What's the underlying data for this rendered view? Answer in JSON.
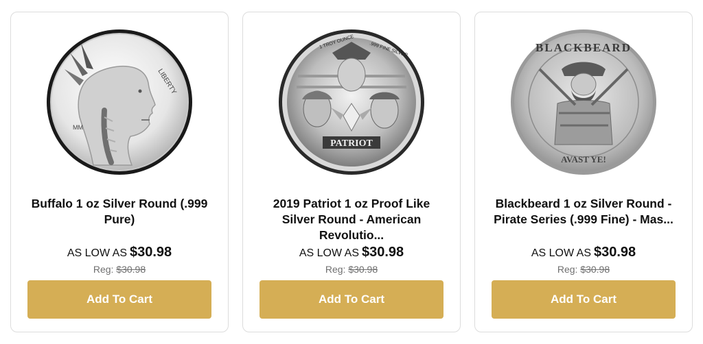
{
  "products": [
    {
      "title": "Buffalo 1 oz Silver Round (.999 Pure)",
      "price_prefix": "AS LOW AS",
      "price": "$30.98",
      "reg_label": "Reg:",
      "reg_price": "$30.98",
      "button_label": "Add To Cart",
      "image_icon": "buffalo-silver-round-coin",
      "coin_text": [
        "LIBERTY",
        "MM"
      ]
    },
    {
      "title": "2019 Patriot 1 oz Proof Like Silver Round - American Revolutio...",
      "price_prefix": "AS LOW AS",
      "price": "$30.98",
      "reg_label": "Reg:",
      "reg_price": "$30.98",
      "button_label": "Add To Cart",
      "image_icon": "patriot-silver-round-coin",
      "coin_text": [
        "1 TROY OUNCE",
        ".999 FINE SILVER",
        "PATRIOT"
      ]
    },
    {
      "title": "Blackbeard 1 oz Silver Round - Pirate Series (.999 Fine) - Mas...",
      "price_prefix": "AS LOW AS",
      "price": "$30.98",
      "reg_label": "Reg:",
      "reg_price": "$30.98",
      "button_label": "Add To Cart",
      "image_icon": "blackbeard-silver-round-coin",
      "coin_text": [
        "BLACKBEARD",
        "AVAST YE!"
      ]
    }
  ],
  "colors": {
    "button_bg": "#d5ae55",
    "button_text": "#ffffff",
    "card_border": "#dcdcdc",
    "reg_text": "#6f6f6f"
  }
}
